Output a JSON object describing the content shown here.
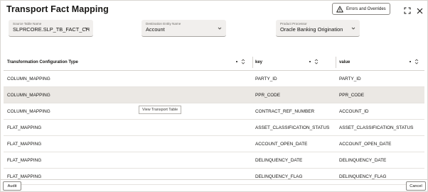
{
  "header": {
    "title": "Transport Fact Mapping",
    "errors_button": "Errors and Overrides"
  },
  "fields": {
    "source": {
      "label": "Source Table Name",
      "value": "SLPRCORE.SLP_TB_FACT_CH"
    },
    "destination": {
      "label": "Destination Entity Name",
      "value": "Account"
    },
    "processor": {
      "label": "Product Processor",
      "value": "Oracle Banking Origination"
    }
  },
  "table": {
    "columns": [
      "Transformation Configuration Type",
      "key",
      "value"
    ],
    "rows": [
      {
        "type": "COLUMN_MAPPING",
        "key": "PARTY_ID",
        "value": "PARTY_ID"
      },
      {
        "type": "COLUMN_MAPPING",
        "key": "PPR_CODE",
        "value": "PPR_CODE"
      },
      {
        "type": "COLUMN_MAPPING",
        "key": "CONTRACT_REF_NUMBER",
        "value": "ACCOUNT_ID"
      },
      {
        "type": "FLAT_MAPPING",
        "key": "ASSET_CLASSIFICATION_STATUS",
        "value": "ASSET_CLASSIFICATION_STATUS"
      },
      {
        "type": "FLAT_MAPPING",
        "key": "ACCOUNT_OPEN_DATE",
        "value": "ACCOUNT_OPEN_DATE"
      },
      {
        "type": "FLAT_MAPPING",
        "key": "DELINQUENCY_DATE",
        "value": "DELINQUENCY_DATE"
      },
      {
        "type": "FLAT_MAPPING",
        "key": "DELINQUENCY_FLAG",
        "value": "DELINQUENCY_FLAG"
      }
    ],
    "selected_row": 1
  },
  "tooltip": "View Transport Table",
  "footer": {
    "audit": "Audit",
    "cancel": "Cancel"
  },
  "icons": {
    "warning": "warning-icon",
    "expand": "expand-icon",
    "close": "close-icon",
    "dropdown": "chevron-down-icon",
    "sort": "sort-icon"
  }
}
